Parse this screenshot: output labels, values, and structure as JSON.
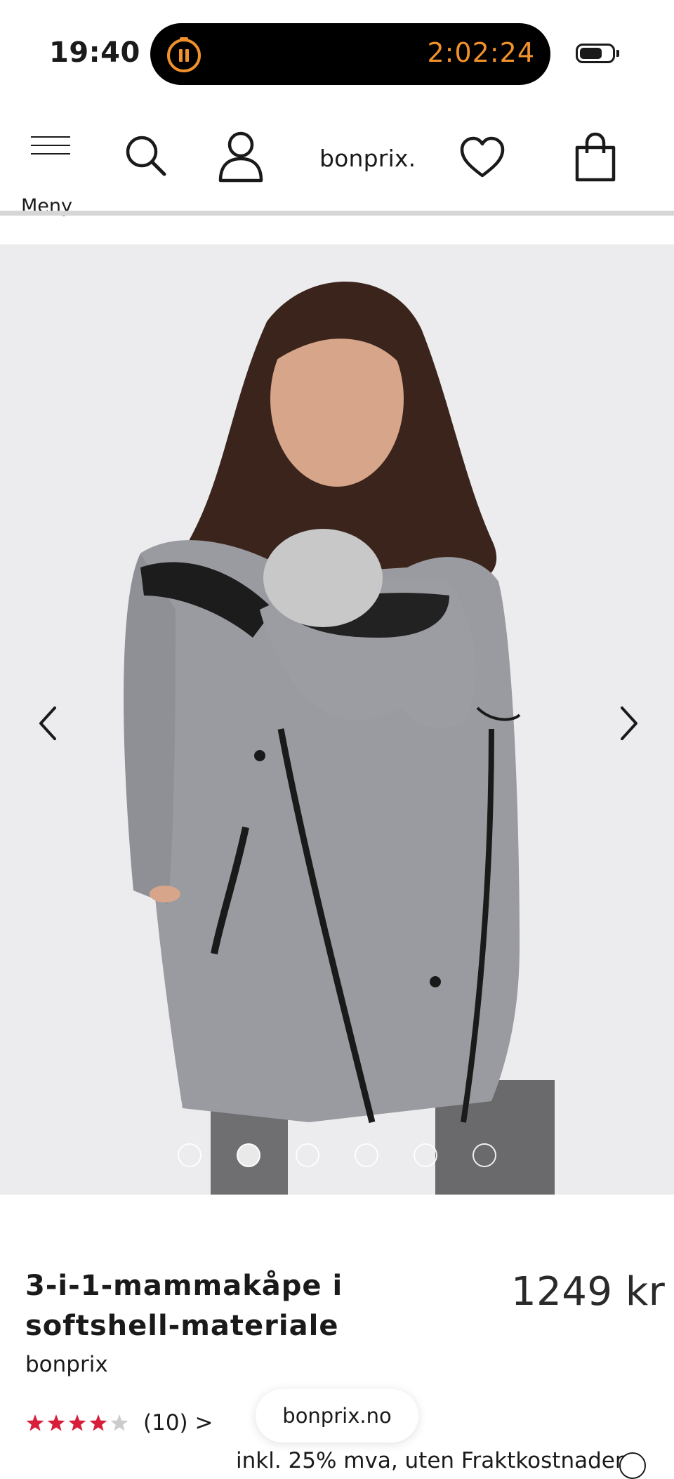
{
  "status_bar": {
    "time": "19:40",
    "timer": "2:02:24",
    "battery_level": 0.7
  },
  "nav": {
    "menu_label": "Meny",
    "logo": "bonprix."
  },
  "gallery": {
    "image_count": 6,
    "active_index": 1
  },
  "product": {
    "title": "3-i-1-mammakåpe i softshell-materiale",
    "price": "1249 kr",
    "brand": "bonprix",
    "rating": 4,
    "rating_max": 5,
    "rating_count": "(10) >",
    "vat_note": "inkl. 25% mva, uten Fraktkostnader"
  },
  "browser": {
    "url": "bonprix.no"
  },
  "colors": {
    "star_filled": "#d81e3a",
    "star_empty": "#cccccc",
    "timer": "#f0922b"
  }
}
